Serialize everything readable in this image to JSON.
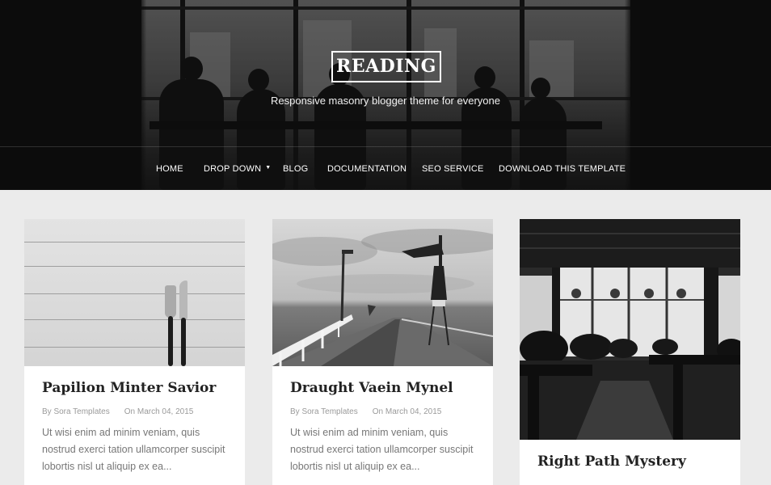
{
  "site": {
    "title": "READING",
    "tagline": "Responsive masonry blogger theme for everyone"
  },
  "nav": {
    "items": [
      {
        "label": "HOME"
      },
      {
        "label": "DROP DOWN",
        "caret": "▼"
      },
      {
        "label": "BLOG"
      },
      {
        "label": "DOCUMENTATION"
      },
      {
        "label": "SEO SERVICE"
      },
      {
        "label": "DOWNLOAD THIS TEMPLATE"
      }
    ]
  },
  "posts": [
    {
      "title": "Papilion Minter Savior",
      "author": "By Sora Templates",
      "date": "On March 04, 2015",
      "excerpt": "Ut wisi enim ad minim veniam, quis nostrud exerci tation ullamcorper suscipit lobortis nisl ut aliquip ex ea..."
    },
    {
      "title": "Draught Vaein Mynel",
      "author": "By Sora Templates",
      "date": "On March 04, 2015",
      "excerpt": "Ut wisi enim ad minim veniam, quis nostrud exerci tation ullamcorper suscipit lobortis nisl ut aliquip ex ea..."
    },
    {
      "title": "Right Path Mystery"
    }
  ],
  "colors": {
    "page_bg": "#ebebeb",
    "header_bg": "#111111",
    "card_bg": "#ffffff",
    "title_text": "#222222",
    "meta_text": "#9a9a9a",
    "excerpt_text": "#777777"
  }
}
